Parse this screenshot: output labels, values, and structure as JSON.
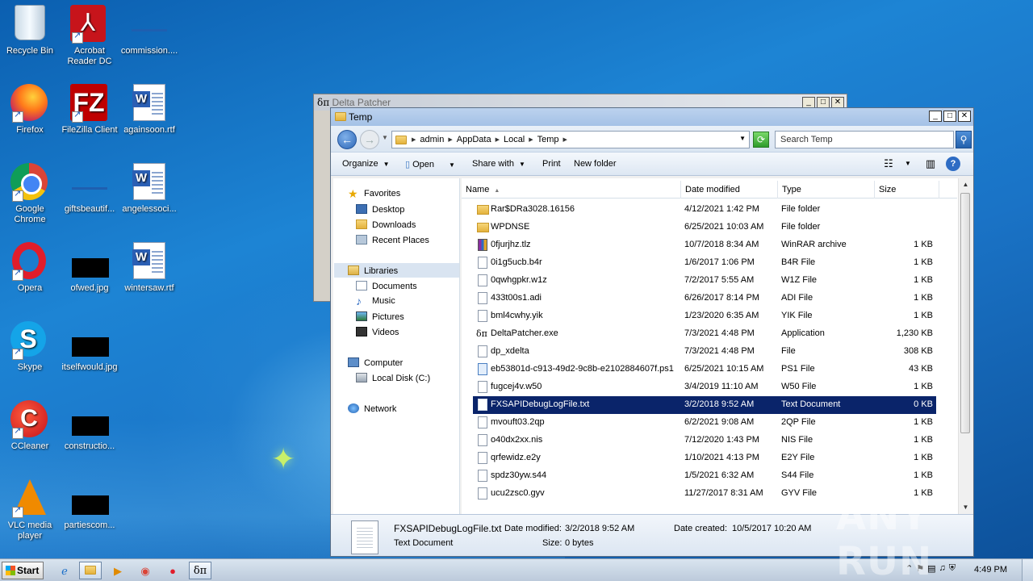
{
  "desktop": {
    "icons": [
      {
        "label": "Recycle Bin",
        "icon": "recycle-bin-icon"
      },
      {
        "label": "Acrobat Reader DC",
        "icon": "acrobat-icon"
      },
      {
        "label": "commission....",
        "icon": "file-icon"
      },
      {
        "label": "Firefox",
        "icon": "firefox-icon"
      },
      {
        "label": "FileZilla Client",
        "icon": "filezilla-icon"
      },
      {
        "label": "againsoon.rtf",
        "icon": "word-doc-icon"
      },
      {
        "label": "Google Chrome",
        "icon": "chrome-icon"
      },
      {
        "label": "giftsbeautif...",
        "icon": "file-icon"
      },
      {
        "label": "angelessoci...",
        "icon": "word-doc-icon"
      },
      {
        "label": "Opera",
        "icon": "opera-icon"
      },
      {
        "label": "ofwed.jpg",
        "icon": "image-icon"
      },
      {
        "label": "wintersaw.rtf",
        "icon": "word-doc-icon"
      },
      {
        "label": "Skype",
        "icon": "skype-icon"
      },
      {
        "label": "itselfwould.jpg",
        "icon": "image-icon"
      },
      {
        "label": "CCleaner",
        "icon": "ccleaner-icon"
      },
      {
        "label": "constructio...",
        "icon": "image-icon"
      },
      {
        "label": "VLC media player",
        "icon": "vlc-icon"
      },
      {
        "label": "partiescom...",
        "icon": "image-icon"
      }
    ]
  },
  "delta_patcher": {
    "title": "Delta Patcher"
  },
  "explorer": {
    "title": "Temp",
    "breadcrumb": [
      "admin",
      "AppData",
      "Local",
      "Temp"
    ],
    "search_placeholder": "Search Temp",
    "commands": {
      "organize": "Organize",
      "open": "Open",
      "share_with": "Share with",
      "print": "Print",
      "new_folder": "New folder"
    },
    "nav": {
      "favorites": "Favorites",
      "desktop": "Desktop",
      "downloads": "Downloads",
      "recent_places": "Recent Places",
      "libraries": "Libraries",
      "documents": "Documents",
      "music": "Music",
      "pictures": "Pictures",
      "videos": "Videos",
      "computer": "Computer",
      "local_disk": "Local Disk (C:)",
      "network": "Network"
    },
    "columns": {
      "name": "Name",
      "date_modified": "Date modified",
      "type": "Type",
      "size": "Size"
    },
    "files": [
      {
        "name": "Rar$DRa3028.16156",
        "date": "4/12/2021 1:42 PM",
        "type": "File folder",
        "size": "",
        "kind": "folder"
      },
      {
        "name": "WPDNSE",
        "date": "6/25/2021 10:03 AM",
        "type": "File folder",
        "size": "",
        "kind": "folder"
      },
      {
        "name": "0fjurjhz.tlz",
        "date": "10/7/2018 8:34 AM",
        "type": "WinRAR archive",
        "size": "1 KB",
        "kind": "rar"
      },
      {
        "name": "0i1g5ucb.b4r",
        "date": "1/6/2017 1:06 PM",
        "type": "B4R File",
        "size": "1 KB",
        "kind": "file"
      },
      {
        "name": "0qwhgpkr.w1z",
        "date": "7/2/2017 5:55 AM",
        "type": "W1Z File",
        "size": "1 KB",
        "kind": "file"
      },
      {
        "name": "433t00s1.adi",
        "date": "6/26/2017 8:14 PM",
        "type": "ADI File",
        "size": "1 KB",
        "kind": "file"
      },
      {
        "name": "bml4cwhy.yik",
        "date": "1/23/2020 6:35 AM",
        "type": "YIK File",
        "size": "1 KB",
        "kind": "file"
      },
      {
        "name": "DeltaPatcher.exe",
        "date": "7/3/2021 4:48 PM",
        "type": "Application",
        "size": "1,230 KB",
        "kind": "app"
      },
      {
        "name": "dp_xdelta",
        "date": "7/3/2021 4:48 PM",
        "type": "File",
        "size": "308 KB",
        "kind": "file"
      },
      {
        "name": "eb53801d-c913-49d2-9c8b-e2102884607f.ps1",
        "date": "6/25/2021 10:15 AM",
        "type": "PS1 File",
        "size": "43 KB",
        "kind": "ps1"
      },
      {
        "name": "fugcej4v.w50",
        "date": "3/4/2019 11:10 AM",
        "type": "W50 File",
        "size": "1 KB",
        "kind": "file"
      },
      {
        "name": "FXSAPIDebugLogFile.txt",
        "date": "3/2/2018 9:52 AM",
        "type": "Text Document",
        "size": "0 KB",
        "kind": "file",
        "selected": true
      },
      {
        "name": "mvouft03.2qp",
        "date": "6/2/2021 9:08 AM",
        "type": "2QP File",
        "size": "1 KB",
        "kind": "file"
      },
      {
        "name": "o40dx2xx.nis",
        "date": "7/12/2020 1:43 PM",
        "type": "NIS File",
        "size": "1 KB",
        "kind": "file"
      },
      {
        "name": "qrfewidz.e2y",
        "date": "1/10/2021 4:13 PM",
        "type": "E2Y File",
        "size": "1 KB",
        "kind": "file"
      },
      {
        "name": "spdz30yw.s44",
        "date": "1/5/2021 6:32 AM",
        "type": "S44 File",
        "size": "1 KB",
        "kind": "file"
      },
      {
        "name": "ucu2zsc0.gyv",
        "date": "11/27/2017 8:31 AM",
        "type": "GYV File",
        "size": "1 KB",
        "kind": "file"
      }
    ],
    "details": {
      "name": "FXSAPIDebugLogFile.txt",
      "type": "Text Document",
      "date_modified_label": "Date modified:",
      "date_modified": "3/2/2018 9:52 AM",
      "date_created_label": "Date created:",
      "date_created": "10/5/2017 10:20 AM",
      "size_label": "Size:",
      "size": "0 bytes"
    }
  },
  "taskbar": {
    "start_label": "Start",
    "clock": "4:49 PM",
    "apps": [
      "internet-explorer-icon",
      "explorer-icon",
      "media-player-icon",
      "chrome-icon",
      "opera-icon",
      "delta-patcher-icon"
    ]
  },
  "watermark": "ANY RUN"
}
